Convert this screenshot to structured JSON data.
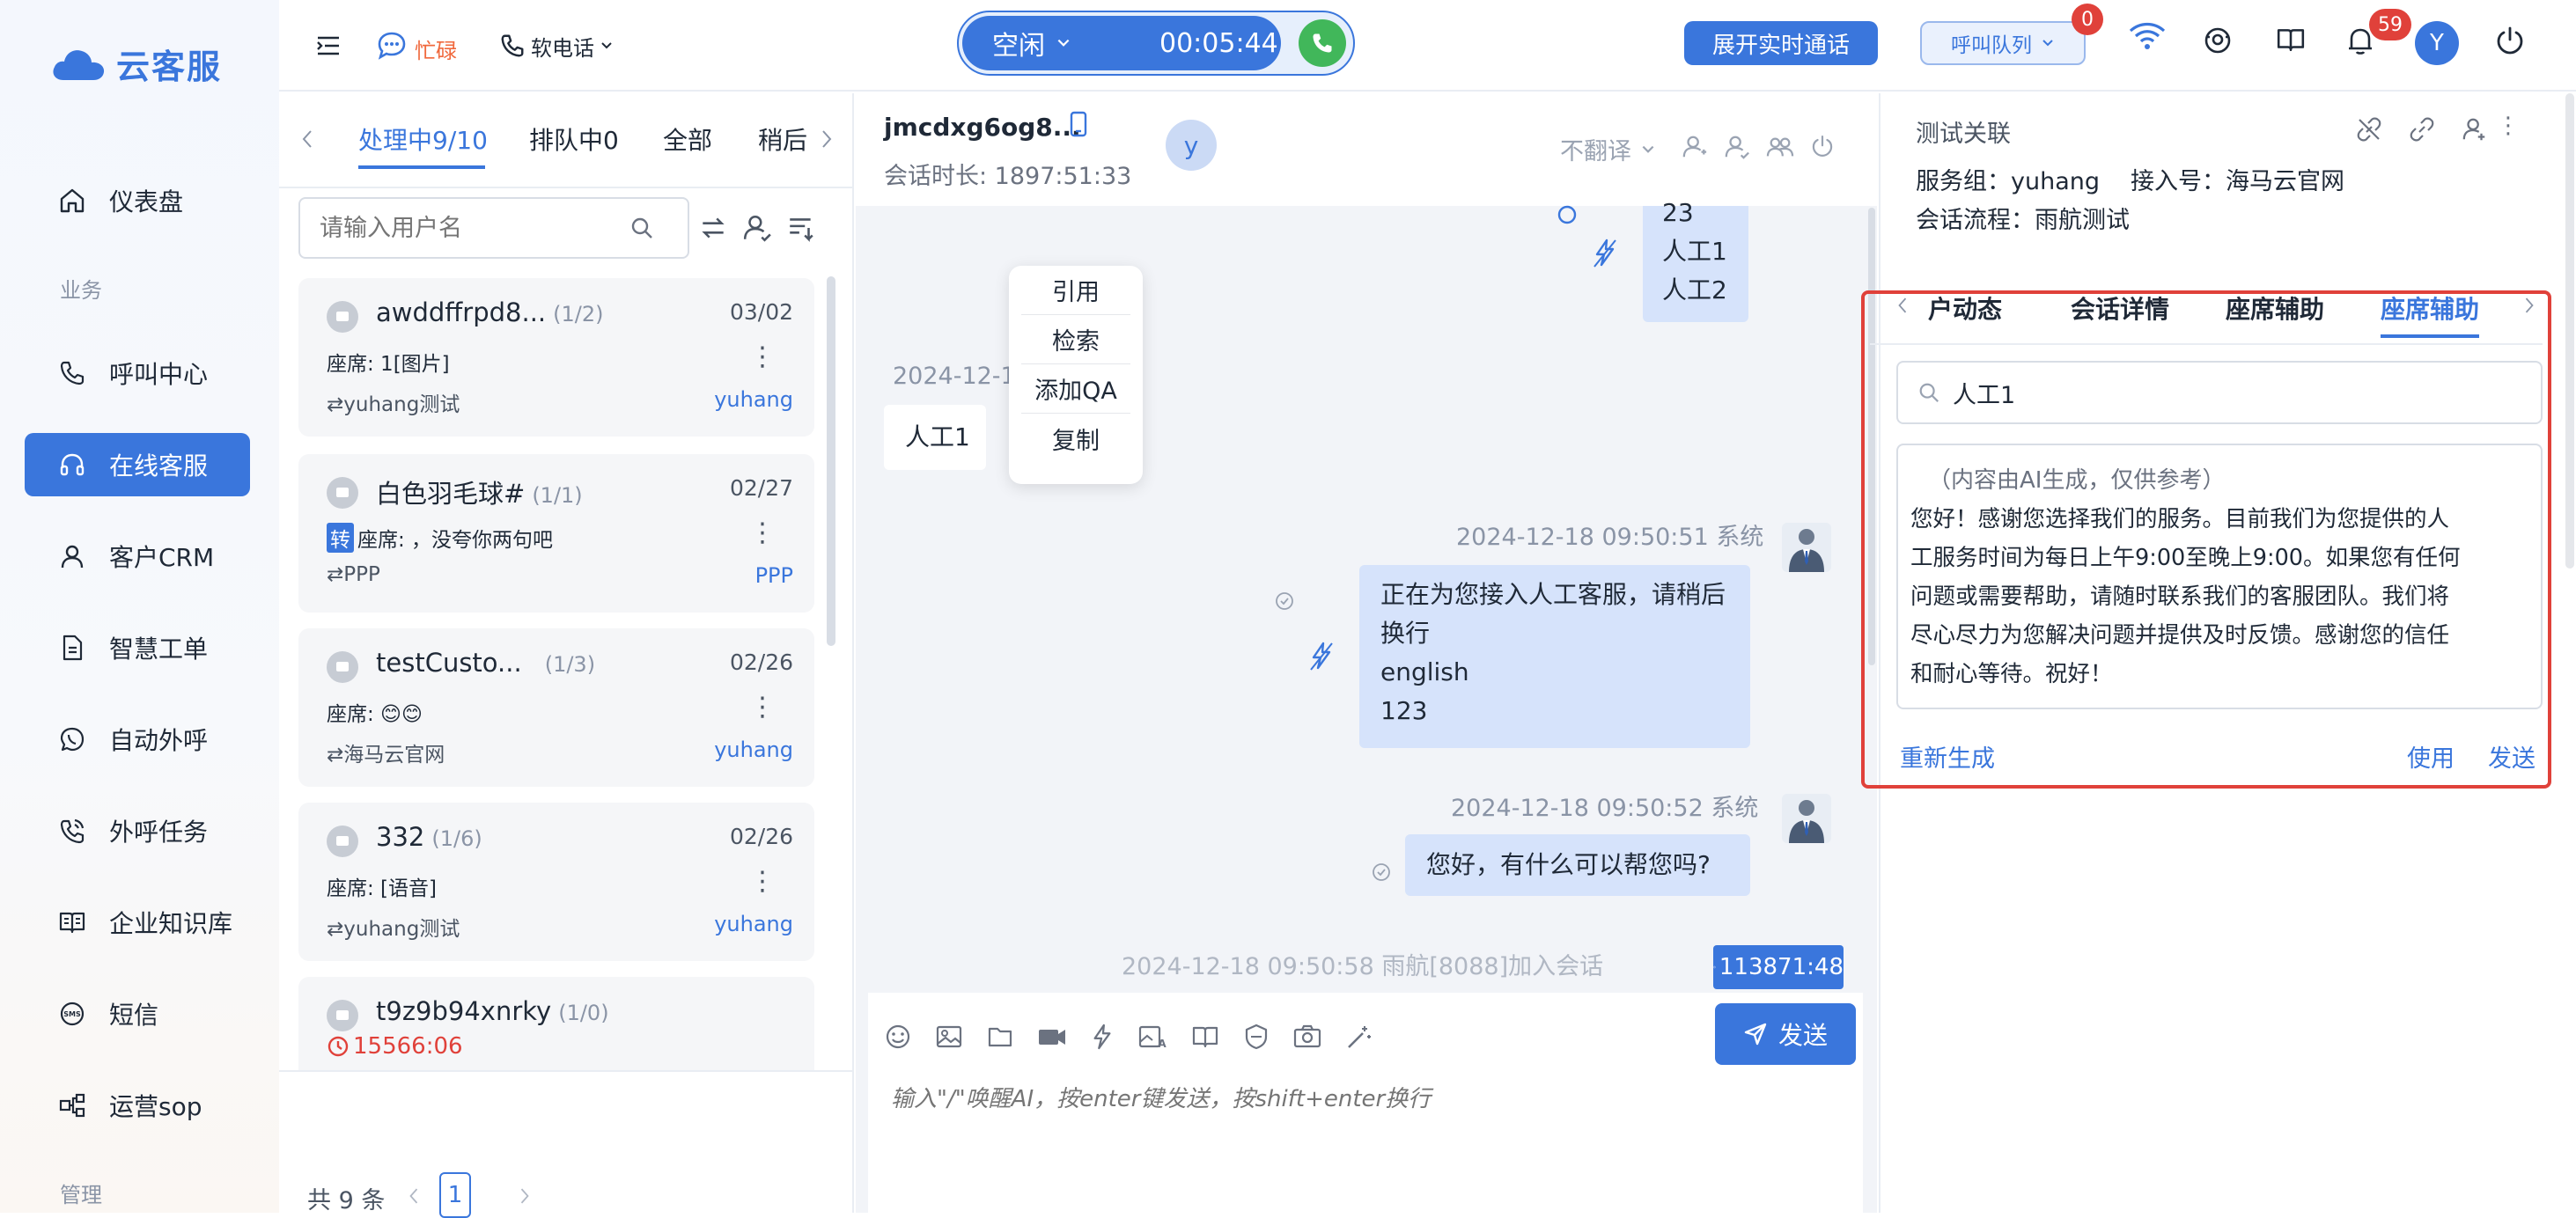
{
  "brand": {
    "name": "云客服"
  },
  "sidebar": {
    "items": [
      {
        "label": "仪表盘",
        "icon": "home-icon"
      },
      {
        "section": "业务"
      },
      {
        "label": "呼叫中心",
        "icon": "phone-icon"
      },
      {
        "label": "在线客服",
        "icon": "headset-icon",
        "active": true
      },
      {
        "label": "客户CRM",
        "icon": "user-icon"
      },
      {
        "label": "智慧工单",
        "icon": "document-icon"
      },
      {
        "label": "自动外呼",
        "icon": "whatsapp-icon"
      },
      {
        "label": "外呼任务",
        "icon": "phone-outgoing-icon"
      },
      {
        "label": "企业知识库",
        "icon": "book-icon"
      },
      {
        "label": "短信",
        "icon": "sms-icon"
      },
      {
        "label": "运营sop",
        "icon": "flow-icon"
      },
      {
        "section": "管理"
      }
    ],
    "section_business": "业务",
    "section_manage": "管理"
  },
  "topbar": {
    "busy_label": "忙碌",
    "softphone_label": "软电话",
    "status": "空闲",
    "timer": "00:05:44",
    "expand_call_button": "展开实时通话",
    "queue_button": "呼叫队列",
    "queue_badge": "0",
    "notif_badge": "59",
    "avatar_letter": "Y"
  },
  "conversations": {
    "tabs": [
      "处理中9/10",
      "排队中0",
      "全部",
      "稍后"
    ],
    "active_tab": "处理中9/10",
    "search_placeholder": "请输入用户名",
    "items": [
      {
        "name": "awddffrpd8...",
        "count": "(1/2)",
        "date": "03/02",
        "message": "座席: 1[图片]",
        "source": "yuhang测试",
        "agent": "yuhang"
      },
      {
        "name": "白色羽毛球#",
        "count": "(1/1)",
        "date": "02/27",
        "transfer_tag": "转",
        "message": "座席: ，没夸你两句吧",
        "source": "PPP",
        "agent": "PPP"
      },
      {
        "name": "testCusto...",
        "count": "(1/3)",
        "date": "02/26",
        "message": "座席: 😊😊",
        "source": "海马云官网",
        "agent": "yuhang"
      },
      {
        "name": "332",
        "count": "(1/6)",
        "date": "02/26",
        "message": "座席: [语音]",
        "source": "yuhang测试",
        "agent": "yuhang"
      },
      {
        "name": "t9z9b94xnrky",
        "count": "(1/0)",
        "timer": "15566:06"
      }
    ],
    "total_label": "共 9 条",
    "current_page": "1"
  },
  "chat": {
    "title": "jmcdxg6og8...",
    "duration": "会话时长: 1897:51:33",
    "user_avatar": "y",
    "translate": "不翻译",
    "context_menu": [
      "引用",
      "检索",
      "添加QA",
      "复制"
    ],
    "top_bubble_lines": [
      "23",
      "人工1",
      "人工2"
    ],
    "user_msg_time": "2024-12-1",
    "user_msg": "人工1",
    "msg1_meta": "2024-12-18 09:50:51 系统",
    "msg1_lines": [
      "正在为您接入人工客服，请稍后",
      "换行",
      "english",
      "123"
    ],
    "msg2_meta": "2024-12-18 09:50:52 系统",
    "msg2_text": "您好，有什么可以帮您吗?",
    "join_notice": "2024-12-18 09:50:58 雨航[8088]加入会话",
    "session_timer": "113871:48",
    "send_button": "发送",
    "input_placeholder": "输入\"/\"唤醒AI，按enter键发送，按shift+enter换行"
  },
  "right_panel": {
    "title": "测试关联",
    "service_group": "服务组：yuhang",
    "access_no": "接入号：海马云官网",
    "flow": "会话流程：雨航测试",
    "tabs": [
      "户动态",
      "会话详情",
      "座席辅助",
      "座席辅助"
    ],
    "active_tab_index": 3,
    "search_value": "人工1",
    "ai_note": "（内容由AI生成，仅供参考）",
    "ai_lines": [
      "您好！感谢您选择我们的服务。目前我们为您提供的人",
      "工服务时间为每日上午9:00至晚上9:00。如果您有任何",
      "问题或需要帮助，请随时联系我们的客服团队。我们将",
      "尽心尽力为您解决问题并提供及时反馈。感谢您的信任",
      "和耐心等待。祝好！"
    ],
    "regenerate": "重新生成",
    "use": "使用",
    "send": "发送"
  },
  "colors": {
    "primary": "#3a76dc",
    "highlight": "#e0413a",
    "online": "#41b75a",
    "busy": "#f0683c"
  }
}
